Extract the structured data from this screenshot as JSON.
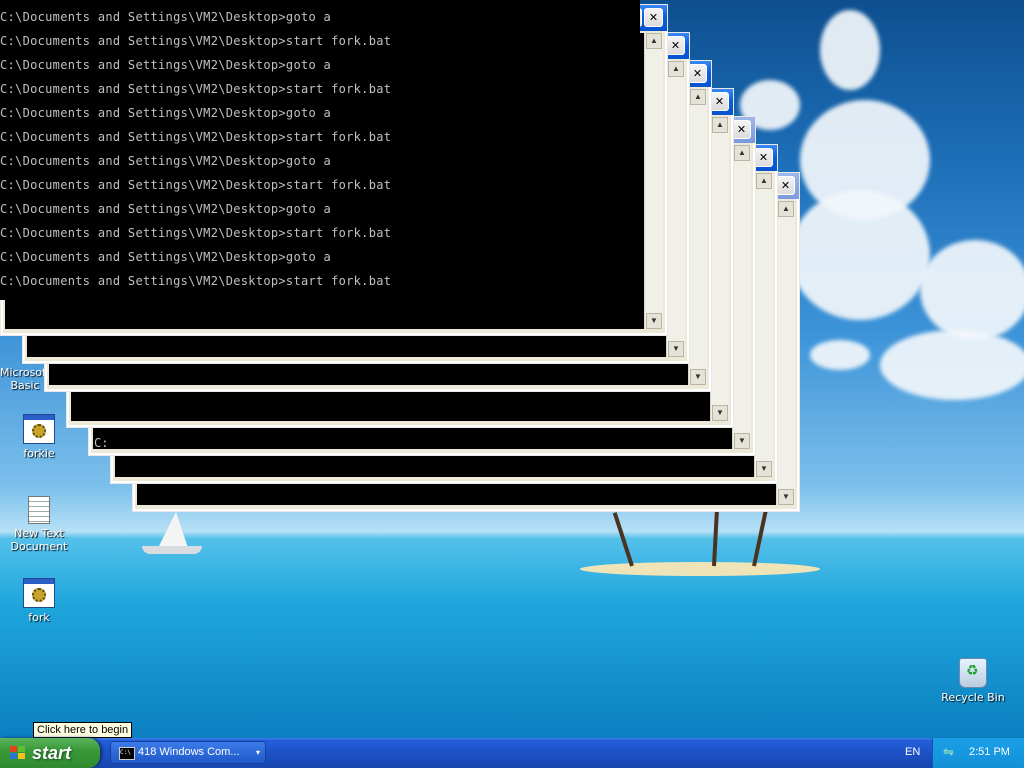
{
  "console": {
    "lines": [
      "C:\\Documents and Settings\\VM2\\Desktop>goto a",
      "C:\\Documents and Settings\\VM2\\Desktop>start fork.bat",
      "C:\\Documents and Settings\\VM2\\Desktop>goto a",
      "C:\\Documents and Settings\\VM2\\Desktop>start fork.bat",
      "C:\\Documents and Settings\\VM2\\Desktop>goto a",
      "C:\\Documents and Settings\\VM2\\Desktop>start fork.bat",
      "C:\\Documents and Settings\\VM2\\Desktop>goto a",
      "C:\\Documents and Settings\\VM2\\Desktop>start fork.bat",
      "C:\\Documents and Settings\\VM2\\Desktop>goto a",
      "C:\\Documents and Settings\\VM2\\Desktop>start fork.bat",
      "C:\\Documents and Settings\\VM2\\Desktop>goto a",
      "C:\\Documents and Settings\\VM2\\Desktop>start fork.bat"
    ],
    "fragment": "C:"
  },
  "window_controls": {
    "minimize": "–",
    "maximize": "☐",
    "close": "✕",
    "scroll_up": "▲",
    "scroll_down": "▼"
  },
  "desktop_icons": {
    "ms_basic": "Microsoft Basic",
    "forkie": "forkie",
    "new_text": "New Text Document",
    "fork": "fork",
    "recycle_bin": "Recycle Bin"
  },
  "tooltip": "Click here to begin",
  "taskbar": {
    "start_label": "start",
    "task_button_label": "418 Windows Com...",
    "task_button_icon_text": "C:\\",
    "task_arrow": "▾",
    "language": "EN",
    "clock": "2:51 PM"
  },
  "colors": {
    "console_text": "#c0c0c0",
    "titlebar_active": "#0a5de0",
    "taskbar": "#245edb",
    "start_button": "#3a9a3a"
  }
}
